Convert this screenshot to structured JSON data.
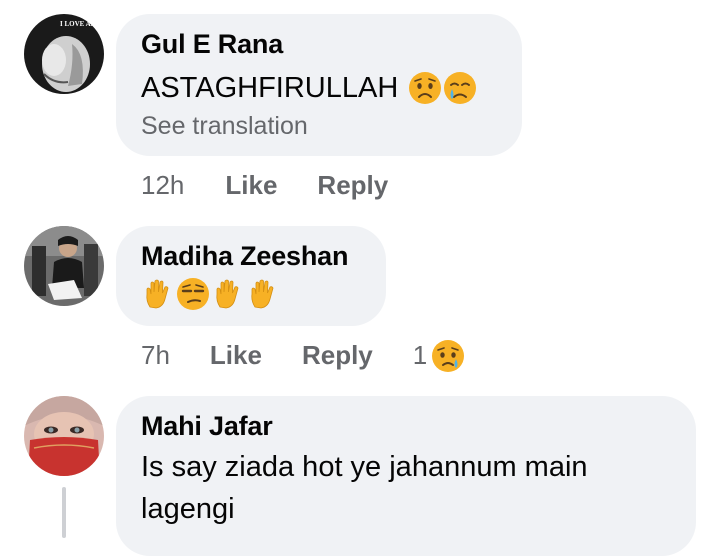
{
  "comments": [
    {
      "author": "Gul E Rana",
      "avatar_caption": "I LOVE Allah",
      "text": "ASTAGHFIRULLAH",
      "emojis": [
        "worried-face-icon",
        "crying-face-icon"
      ],
      "see_translation": "See translation",
      "time": "12h",
      "like": "Like",
      "reply": "Reply"
    },
    {
      "author": "Madiha Zeeshan",
      "emojis": [
        "raised-hand-icon",
        "unamused-face-icon",
        "raised-hand-icon",
        "raised-hand-icon"
      ],
      "time": "7h",
      "like": "Like",
      "reply": "Reply",
      "reaction_count": "1",
      "reaction_icon": "sad-reaction-icon"
    },
    {
      "author": "Mahi Jafar",
      "text": "Is say ziada hot ye jahannum main lagengi"
    }
  ],
  "colors": {
    "bubble": "#f0f2f5",
    "secondary_text": "#65676b",
    "primary_text": "#050505",
    "emoji_yellow": "#f7b125"
  }
}
